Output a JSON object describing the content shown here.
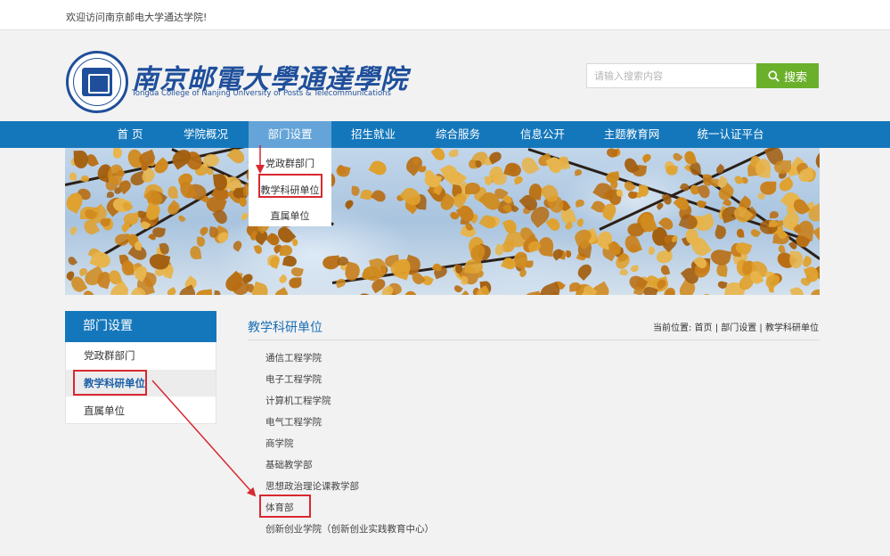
{
  "topbar": {
    "welcome": "欢迎访问南京邮电大学通达学院!"
  },
  "header": {
    "logo_cn": "南京邮電大學通達學院",
    "logo_en": "Tongda College of Nanjing University of Posts & Telecommunications",
    "search": {
      "placeholder": "请输入搜索内容",
      "button_label": "搜索"
    }
  },
  "nav": {
    "items": [
      "首 页",
      "学院概况",
      "部门设置",
      "招生就业",
      "综合服务",
      "信息公开",
      "主题教育网",
      "统一认证平台"
    ],
    "active_index": 2,
    "dropdown": [
      "党政群部门",
      "教学科研单位",
      "直属单位"
    ]
  },
  "sidebar": {
    "title": "部门设置",
    "items": [
      "党政群部门",
      "教学科研单位",
      "直属单位"
    ],
    "active_index": 1
  },
  "content": {
    "title": "教学科研单位",
    "breadcrumb": "当前位置: 首页 | 部门设置 | 教学科研单位",
    "items": [
      "通信工程学院",
      "电子工程学院",
      "计算机工程学院",
      "电气工程学院",
      "商学院",
      "基础教学部",
      "思想政治理论课教学部",
      "体育部",
      "创新创业学院（创新创业实践教育中心）"
    ]
  },
  "colors": {
    "nav_blue": "#1577bb",
    "nav_active": "#64a4d8",
    "search_green": "#6ab02a",
    "annotation_red": "#d9282f",
    "logo_blue": "#1f4f9b"
  }
}
